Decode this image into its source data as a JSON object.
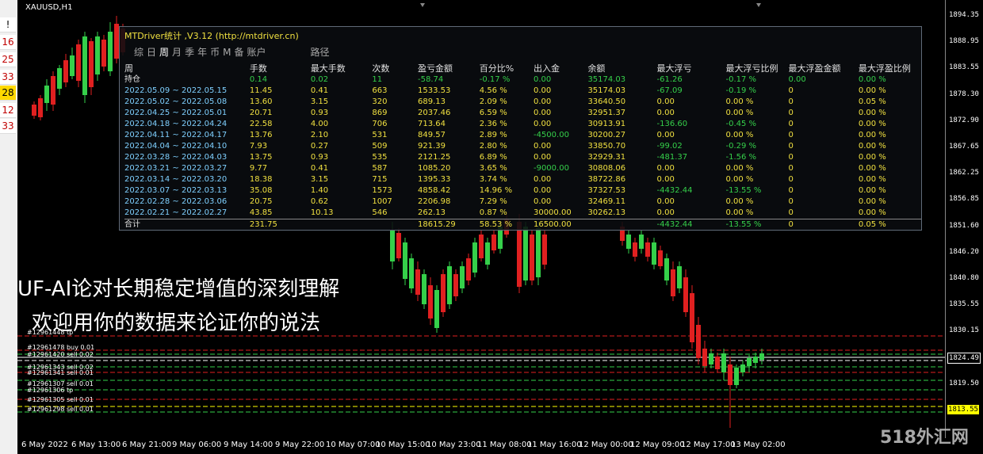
{
  "left_panel": {
    "items": [
      "!",
      "16",
      "25",
      "33",
      "28",
      "12",
      "33"
    ]
  },
  "chart": {
    "symbol": "XAUUSD,H1"
  },
  "price_axis": {
    "ticks": [
      "1894.35",
      "1888.95",
      "1883.55",
      "1878.30",
      "1872.90",
      "1867.65",
      "1862.25",
      "1856.85",
      "1851.60",
      "1846.20",
      "1840.80",
      "1835.55",
      "1830.15",
      "1824.75",
      "1819.50",
      "1813.55"
    ],
    "current_price": "1824.49",
    "yellow_price": "1813.55"
  },
  "time_axis": {
    "ticks": [
      "6 May 2022",
      "6 May 13:00",
      "6 May 21:00",
      "9 May 06:00",
      "9 May 14:00",
      "9 May 22:00",
      "10 May 07:00",
      "10 May 15:00",
      "10 May 23:00",
      "11 May 08:00",
      "11 May 16:00",
      "12 May 00:00",
      "12 May 09:00",
      "12 May 17:00",
      "13 May 02:00"
    ]
  },
  "panel": {
    "title": "MTDriver统计 ,V3.12 (http://mtdriver.cn)",
    "tabs": [
      "综",
      "日",
      "周",
      "月",
      "季",
      "年",
      "币",
      "M",
      "备",
      "账户",
      "路径"
    ],
    "active_tab": "周",
    "headers": [
      "周",
      "手数",
      "最大手数",
      "次数",
      "盈亏金额",
      "百分比%",
      "出入金",
      "余额",
      "最大浮亏",
      "最大浮亏比例",
      "最大浮盈金额",
      "最大浮盈比例"
    ],
    "holding": [
      "持仓",
      "0.14",
      "0.02",
      "11",
      "-58.74",
      "-0.17 %",
      "0.00",
      "35174.03",
      "-61.26",
      "-0.17 %",
      "0.00",
      "0.00 %"
    ],
    "rows": [
      [
        "2022.05.09 ~ 2022.05.15",
        "11.45",
        "0.41",
        "663",
        "1533.53",
        "4.56 %",
        "0.00",
        "35174.03",
        "-67.09",
        "-0.19 %",
        "0",
        "0.00 %"
      ],
      [
        "2022.05.02 ~ 2022.05.08",
        "13.60",
        "3.15",
        "320",
        "689.13",
        "2.09 %",
        "0.00",
        "33640.50",
        "0.00",
        "0.00 %",
        "0",
        "0.05 %"
      ],
      [
        "2022.04.25 ~ 2022.05.01",
        "20.71",
        "0.93",
        "869",
        "2037.46",
        "6.59 %",
        "0.00",
        "32951.37",
        "0.00",
        "0.00 %",
        "0",
        "0.00 %"
      ],
      [
        "2022.04.18 ~ 2022.04.24",
        "22.58",
        "4.00",
        "706",
        "713.64",
        "2.36 %",
        "0.00",
        "30913.91",
        "-136.60",
        "-0.45 %",
        "0",
        "0.00 %"
      ],
      [
        "2022.04.11 ~ 2022.04.17",
        "13.76",
        "2.10",
        "531",
        "849.57",
        "2.89 %",
        "-4500.00",
        "30200.27",
        "0.00",
        "0.00 %",
        "0",
        "0.00 %"
      ],
      [
        "2022.04.04 ~ 2022.04.10",
        "7.93",
        "0.27",
        "509",
        "921.39",
        "2.80 %",
        "0.00",
        "33850.70",
        "-99.02",
        "-0.29 %",
        "0",
        "0.00 %"
      ],
      [
        "2022.03.28 ~ 2022.04.03",
        "13.75",
        "0.93",
        "535",
        "2121.25",
        "6.89 %",
        "0.00",
        "32929.31",
        "-481.37",
        "-1.56 %",
        "0",
        "0.00 %"
      ],
      [
        "2022.03.21 ~ 2022.03.27",
        "9.77",
        "0.41",
        "587",
        "1085.20",
        "3.65 %",
        "-9000.00",
        "30808.06",
        "0.00",
        "0.00 %",
        "0",
        "0.00 %"
      ],
      [
        "2022.03.14 ~ 2022.03.20",
        "18.38",
        "3.15",
        "715",
        "1395.33",
        "3.74 %",
        "0.00",
        "38722.86",
        "0.00",
        "0.00 %",
        "0",
        "0.00 %"
      ],
      [
        "2022.03.07 ~ 2022.03.13",
        "35.08",
        "1.40",
        "1573",
        "4858.42",
        "14.96 %",
        "0.00",
        "37327.53",
        "-4432.44",
        "-13.55 %",
        "0",
        "0.00 %"
      ],
      [
        "2022.02.28 ~ 2022.03.06",
        "20.75",
        "0.62",
        "1007",
        "2206.98",
        "7.29 %",
        "0.00",
        "32469.11",
        "0.00",
        "0.00 %",
        "0",
        "0.00 %"
      ],
      [
        "2022.02.21 ~ 2022.02.27",
        "43.85",
        "10.13",
        "546",
        "262.13",
        "0.87 %",
        "30000.00",
        "30262.13",
        "0.00",
        "0.00 %",
        "0",
        "0.00 %"
      ]
    ],
    "total": [
      "合计",
      "231.75",
      "",
      "",
      "18615.29",
      "58.53 %",
      "16500.00",
      "",
      "-4432.44",
      "-13.55 %",
      "0",
      "0.05 %"
    ]
  },
  "overlay": {
    "line1": "UF-AI论对长期稳定增值的深刻理解",
    "line2": "欢迎用你的数据来论证你的说法"
  },
  "orders": [
    "#12961448 tp",
    "#12961478 buy 0.01",
    "#12961420 sell 0.02",
    "#12961343 sell 0.02",
    "#12961341 sell 0.01",
    "#12961307 sell 0.01",
    "#12961306 tp",
    "#12961305 sell 0.01",
    "#12961298 sell 0.01"
  ],
  "watermark": "518外汇网",
  "colors": {
    "bull": "#35d04a",
    "bear": "#e02020",
    "panel_yellow": "#f0e040"
  }
}
